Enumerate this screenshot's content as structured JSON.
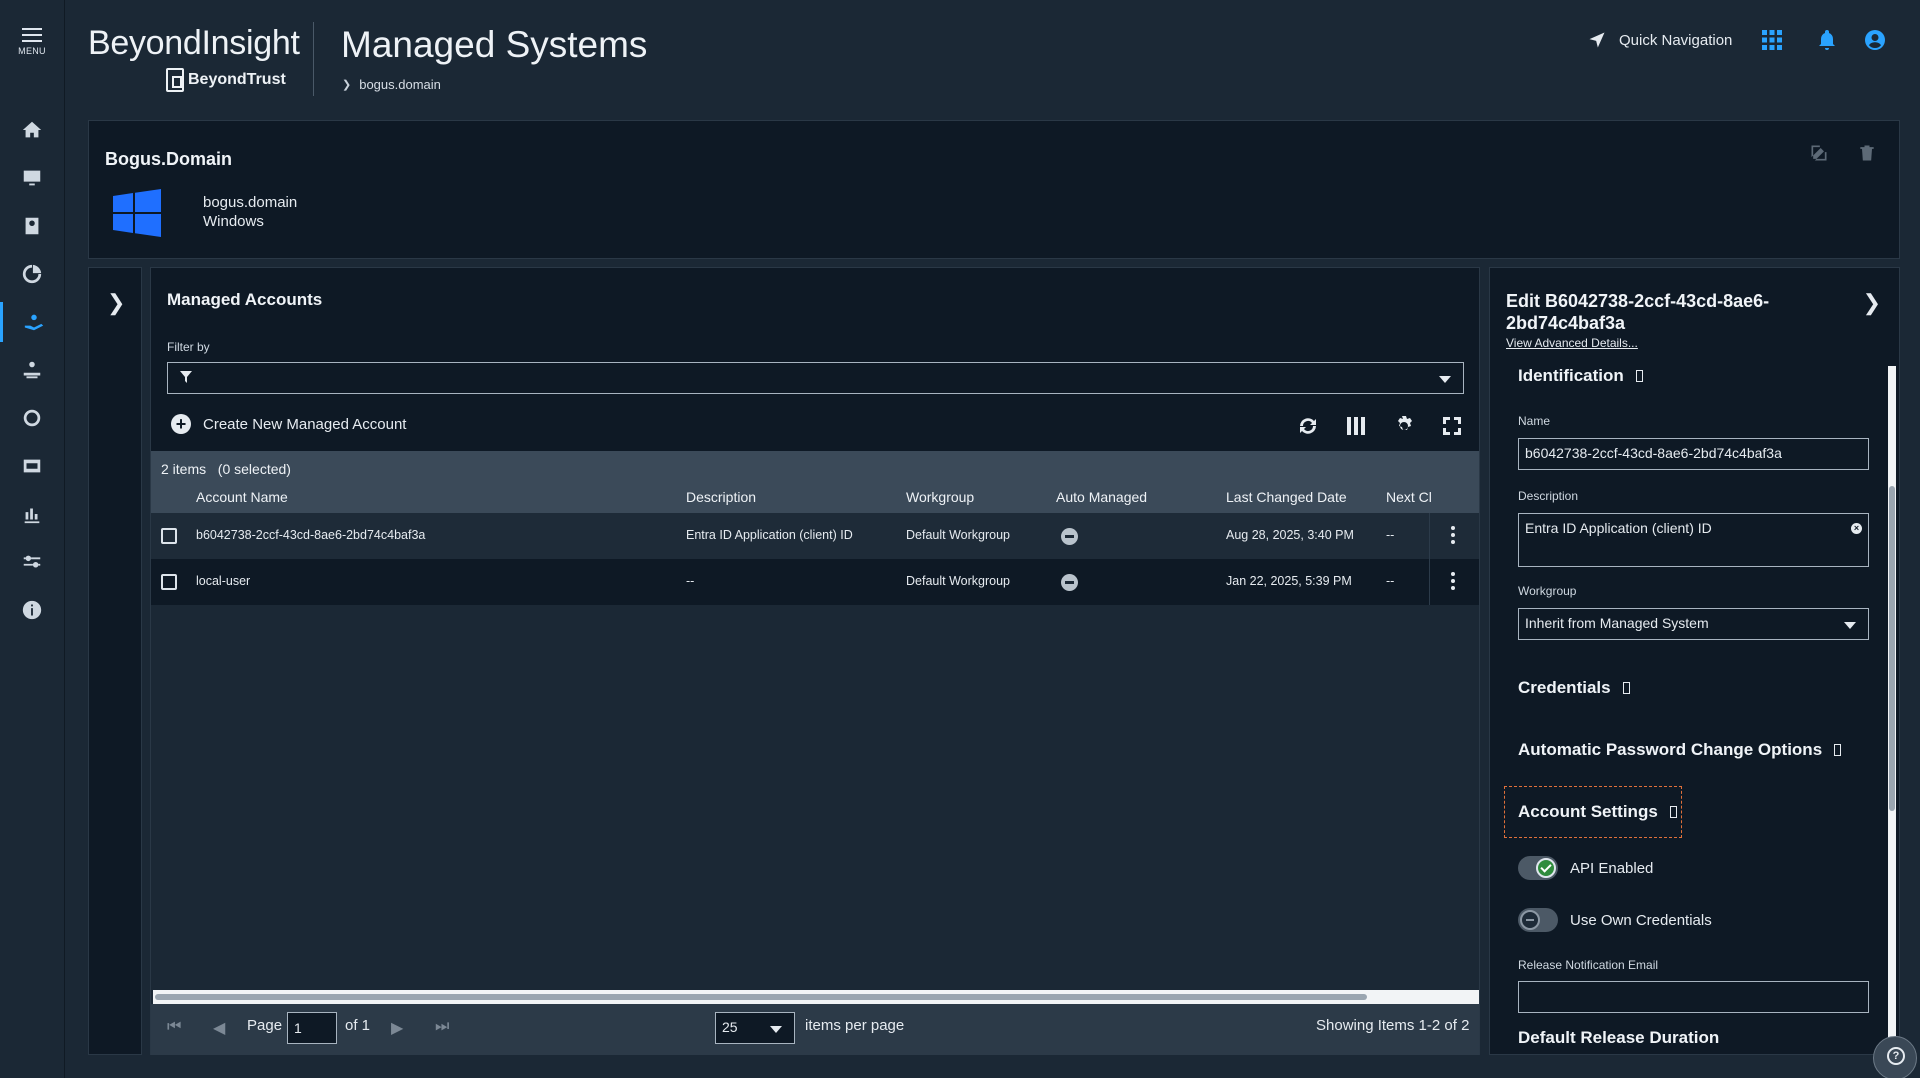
{
  "nav": {
    "menu_label": "MENU",
    "items": [
      "home-icon",
      "monitor-icon",
      "vault-icon",
      "analytics-icon",
      "managed-accounts-icon",
      "requests-icon",
      "network-icon",
      "sessions-icon",
      "reports-icon",
      "settings-icon",
      "info-icon"
    ],
    "active": "managed-accounts-icon"
  },
  "header": {
    "brand": "BeyondInsight",
    "brand_sub": "BeyondTrust",
    "page_title": "Managed Systems",
    "breadcrumb": "bogus.domain",
    "quick_nav": "Quick Navigation"
  },
  "system": {
    "title": "Bogus.Domain",
    "name": "bogus.domain",
    "platform": "Windows"
  },
  "accounts": {
    "title": "Managed Accounts",
    "filter_label": "Filter by",
    "create_label": "Create New Managed Account",
    "count": "2 items",
    "selected": "(0 selected)",
    "columns": [
      "Account Name",
      "Description",
      "Workgroup",
      "Auto Managed",
      "Last Changed Date",
      "Next Cl"
    ],
    "rows": [
      {
        "account": "b6042738-2ccf-43cd-8ae6-2bd74c4baf3a",
        "description": "Entra ID Application (client) ID",
        "workgroup": "Default Workgroup",
        "last_changed": "Aug 28, 2025, 3:40 PM",
        "next": "--"
      },
      {
        "account": "local-user",
        "description": "--",
        "workgroup": "Default Workgroup",
        "last_changed": "Jan 22, 2025, 5:39 PM",
        "next": "--"
      }
    ],
    "pager": {
      "page_label": "Page",
      "page_value": "1",
      "of_label": "of 1",
      "per_page": "25",
      "per_page_label": "items per page",
      "showing": "Showing Items 1-2 of 2"
    }
  },
  "edit": {
    "title": "Edit B6042738-2ccf-43cd-8ae6-2bd74c4baf3a",
    "advanced_link": "View Advanced Details...",
    "section_identification": "Identification",
    "name_label": "Name",
    "name_value": "b6042738-2ccf-43cd-8ae6-2bd74c4baf3a",
    "description_label": "Description",
    "description_value": "Entra ID Application (client) ID",
    "workgroup_label": "Workgroup",
    "workgroup_value": "Inherit from Managed System",
    "section_credentials": "Credentials",
    "section_auto_pwd": "Automatic Password Change Options",
    "section_account_settings": "Account Settings",
    "api_enabled_label": "API Enabled",
    "api_enabled": true,
    "own_creds_label": "Use Own Credentials",
    "own_creds": false,
    "release_email_label": "Release Notification Email",
    "release_email_value": "",
    "section_release_duration": "Default Release Duration"
  },
  "colors": {
    "background": "#1b2835",
    "panel": "#0e1925",
    "accent": "#2aa3ff",
    "windows_blue": "#1f6fff",
    "toggle_on": "#2f8c3d",
    "focus_outline": "#e0703a"
  }
}
